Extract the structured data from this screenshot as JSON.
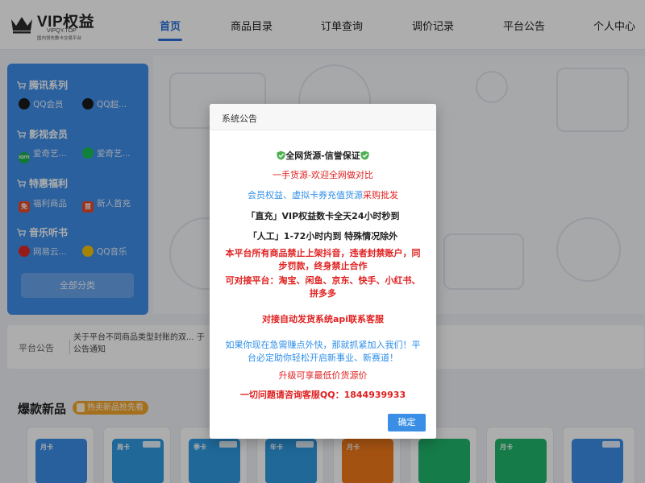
{
  "logo": {
    "title": "VIP权益",
    "domain": "VIPQY.TOP",
    "slogan": "国内领先数卡交易平台"
  },
  "nav": [
    "首页",
    "商品目录",
    "订单查询",
    "调价记录",
    "平台公告",
    "个人中心"
  ],
  "sidebar": {
    "categories": [
      {
        "title": "腾讯系列",
        "items": [
          {
            "label": "QQ会员",
            "icon": "qq-icon",
            "color": "#d33"
          },
          {
            "label": "QQ超...",
            "icon": "qq-svip-icon",
            "color": "#d33"
          }
        ]
      },
      {
        "title": "影视会员",
        "items": [
          {
            "label": "爱奇艺...",
            "icon": "iqiyi-icon",
            "color": "#18b14a",
            "text": "iQIYI"
          },
          {
            "label": "爱奇艺...",
            "icon": "iqiyi-app-icon",
            "color": "#1bbf57"
          }
        ]
      },
      {
        "title": "特惠福利",
        "items": [
          {
            "label": "福利商品",
            "icon": "welfare-icon",
            "color": "#e54d2e",
            "text": "免"
          },
          {
            "label": "新人首充",
            "icon": "new-user-icon",
            "color": "#e54d2e",
            "text": "首"
          }
        ]
      },
      {
        "title": "音乐听书",
        "items": [
          {
            "label": "网易云...",
            "icon": "netease-music-icon",
            "color": "#e02828"
          },
          {
            "label": "QQ音乐",
            "icon": "qq-music-icon",
            "color": "#f4c20d"
          }
        ]
      }
    ],
    "all_label": "全部分类"
  },
  "notice": {
    "label": "平台公告",
    "text": "关于平台不同商品类型封账的双... 于公告通知"
  },
  "new_products": {
    "title": "爆款新品",
    "tag": "热卖新品抢先看"
  },
  "cards": [
    {
      "label": "月卡",
      "color": "#3a8ee6"
    },
    {
      "label": "周卡",
      "color": "#2f9ae0"
    },
    {
      "label": "季卡",
      "color": "#2f9ae0"
    },
    {
      "label": "年卡",
      "color": "#2f9ae0"
    },
    {
      "label": "月卡",
      "color": "#f27a1a"
    },
    {
      "label": "",
      "color": "#1fb56a"
    },
    {
      "label": "月卡",
      "color": "#1fb56a"
    },
    {
      "label": "",
      "color": "#3a8ee6"
    }
  ],
  "modal": {
    "title": "系统公告",
    "line1": "全网货源-信誉保证",
    "line2": "一手货源-欢迎全网做对比",
    "line3a": "会员权益、虚拟卡券充值货源",
    "line3b": "采购批发",
    "line4": "「直充」VIP权益数卡全天24小时秒到",
    "line5": "「人工」1-72小时内到 特殊情况除外",
    "line6a": "本平台所有商品禁止上架抖音，违者封禁账户，同",
    "line6b": "步罚款，终身禁止合作",
    "line7a": "可对接平台：淘宝、闲鱼、京东、快手、小红书、",
    "line7b": "拼多多",
    "line8": "对接自动发货系统api联系客服",
    "line9a": "如果你现在急需赚点外快，那就抓紧加入我们！平",
    "line9b": "台必定助你轻松开启新事业、新赛道！",
    "line10": "升级可享最低价货源价",
    "line11": "一切问题请咨询客服QQ：1844939933",
    "confirm": "确定"
  }
}
